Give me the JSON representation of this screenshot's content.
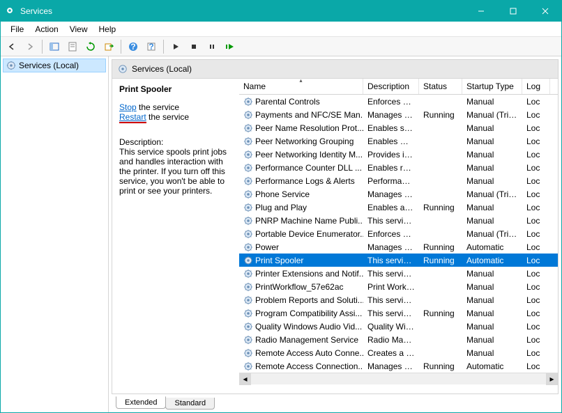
{
  "window": {
    "title": "Services"
  },
  "menu": {
    "file": "File",
    "action": "Action",
    "view": "View",
    "help": "Help"
  },
  "tree": {
    "root": "Services (Local)"
  },
  "pane": {
    "title": "Services (Local)"
  },
  "detail": {
    "selected_name": "Print Spooler",
    "stop_link": "Stop",
    "stop_tail": " the service",
    "restart_link": "Restart",
    "restart_tail": " the service",
    "desc_label": "Description:",
    "desc_text": "This service spools print jobs and handles interaction with the printer. If you turn off this service, you won't be able to print or see your printers."
  },
  "columns": {
    "name": "Name",
    "desc": "Description",
    "status": "Status",
    "startup": "Startup Type",
    "logon": "Log"
  },
  "tabs": {
    "extended": "Extended",
    "standard": "Standard"
  },
  "rows": [
    {
      "name": "Parental Controls",
      "desc": "Enforces pa...",
      "status": "",
      "startup": "Manual",
      "logon": "Loc"
    },
    {
      "name": "Payments and NFC/SE Man...",
      "desc": "Manages pa...",
      "status": "Running",
      "startup": "Manual (Trig...",
      "logon": "Loc"
    },
    {
      "name": "Peer Name Resolution Prot...",
      "desc": "Enables serv...",
      "status": "",
      "startup": "Manual",
      "logon": "Loc"
    },
    {
      "name": "Peer Networking Grouping",
      "desc": "Enables mul...",
      "status": "",
      "startup": "Manual",
      "logon": "Loc"
    },
    {
      "name": "Peer Networking Identity M...",
      "desc": "Provides ide...",
      "status": "",
      "startup": "Manual",
      "logon": "Loc"
    },
    {
      "name": "Performance Counter DLL ...",
      "desc": "Enables rem...",
      "status": "",
      "startup": "Manual",
      "logon": "Loc"
    },
    {
      "name": "Performance Logs & Alerts",
      "desc": "Performanc...",
      "status": "",
      "startup": "Manual",
      "logon": "Loc"
    },
    {
      "name": "Phone Service",
      "desc": "Manages th...",
      "status": "",
      "startup": "Manual (Trig...",
      "logon": "Loc"
    },
    {
      "name": "Plug and Play",
      "desc": "Enables a c...",
      "status": "Running",
      "startup": "Manual",
      "logon": "Loc"
    },
    {
      "name": "PNRP Machine Name Publi...",
      "desc": "This service ...",
      "status": "",
      "startup": "Manual",
      "logon": "Loc"
    },
    {
      "name": "Portable Device Enumerator...",
      "desc": "Enforces gr...",
      "status": "",
      "startup": "Manual (Trig...",
      "logon": "Loc"
    },
    {
      "name": "Power",
      "desc": "Manages p...",
      "status": "Running",
      "startup": "Automatic",
      "logon": "Loc"
    },
    {
      "name": "Print Spooler",
      "desc": "This service ...",
      "status": "Running",
      "startup": "Automatic",
      "logon": "Loc",
      "selected": true
    },
    {
      "name": "Printer Extensions and Notif...",
      "desc": "This service ...",
      "status": "",
      "startup": "Manual",
      "logon": "Loc"
    },
    {
      "name": "PrintWorkflow_57e62ac",
      "desc": "Print Workfl...",
      "status": "",
      "startup": "Manual",
      "logon": "Loc"
    },
    {
      "name": "Problem Reports and Soluti...",
      "desc": "This service ...",
      "status": "",
      "startup": "Manual",
      "logon": "Loc"
    },
    {
      "name": "Program Compatibility Assi...",
      "desc": "This service ...",
      "status": "Running",
      "startup": "Manual",
      "logon": "Loc"
    },
    {
      "name": "Quality Windows Audio Vid...",
      "desc": "Quality Win...",
      "status": "",
      "startup": "Manual",
      "logon": "Loc"
    },
    {
      "name": "Radio Management Service",
      "desc": "Radio Mana...",
      "status": "",
      "startup": "Manual",
      "logon": "Loc"
    },
    {
      "name": "Remote Access Auto Conne...",
      "desc": "Creates a co...",
      "status": "",
      "startup": "Manual",
      "logon": "Loc"
    },
    {
      "name": "Remote Access Connection...",
      "desc": "Manages di...",
      "status": "Running",
      "startup": "Automatic",
      "logon": "Loc"
    }
  ]
}
